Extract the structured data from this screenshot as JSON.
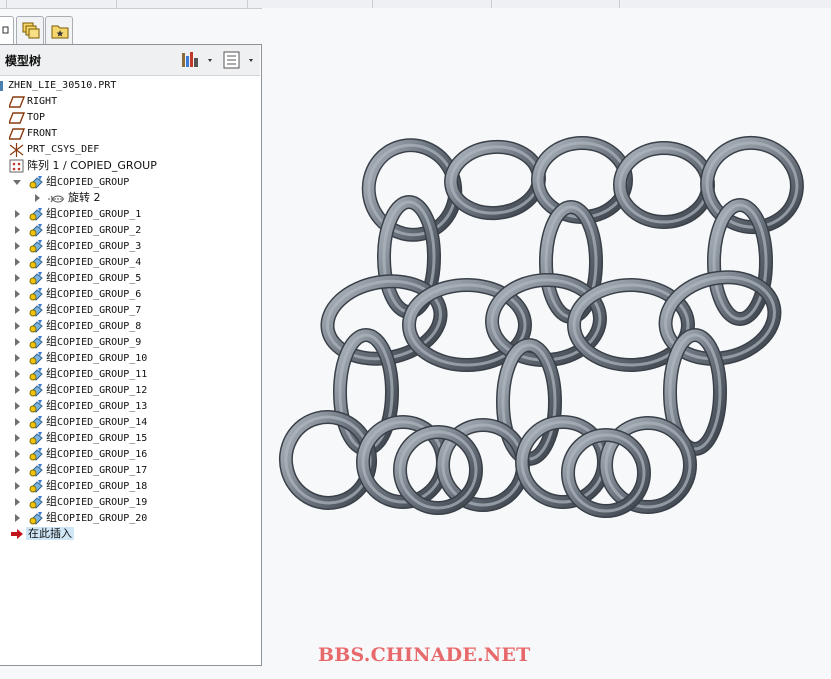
{
  "tabs": [
    {
      "icon": "model-tree-icon"
    },
    {
      "icon": "folder-layers-icon"
    },
    {
      "icon": "favorites-folder-icon"
    }
  ],
  "model_tree": {
    "title": "模型树",
    "settings_icon": "tree-settings-icon",
    "filter_icon": "tree-columns-icon",
    "root": "ZHEN_LIE_30510.PRT",
    "datum_items": [
      {
        "label": "RIGHT",
        "icon": "datum-plane-icon"
      },
      {
        "label": "TOP",
        "icon": "datum-plane-icon"
      },
      {
        "label": "FRONT",
        "icon": "datum-plane-icon"
      },
      {
        "label": "PRT_CSYS_DEF",
        "icon": "coordinate-system-icon"
      }
    ],
    "pattern": {
      "label": "阵列 1 / COPIED_GROUP",
      "icon": "pattern-icon"
    },
    "group_prefix": "组",
    "first_group": "COPIED_GROUP",
    "revolve": "旋转 2",
    "groups": [
      "COPIED_GROUP_1",
      "COPIED_GROUP_2",
      "COPIED_GROUP_3",
      "COPIED_GROUP_4",
      "COPIED_GROUP_5",
      "COPIED_GROUP_6",
      "COPIED_GROUP_7",
      "COPIED_GROUP_8",
      "COPIED_GROUP_9",
      "COPIED_GROUP_10",
      "COPIED_GROUP_11",
      "COPIED_GROUP_12",
      "COPIED_GROUP_13",
      "COPIED_GROUP_14",
      "COPIED_GROUP_15",
      "COPIED_GROUP_16",
      "COPIED_GROUP_17",
      "COPIED_GROUP_18",
      "COPIED_GROUP_19",
      "COPIED_GROUP_20"
    ],
    "insert_here": "在此插入"
  },
  "viewport": {
    "model": "chain-mail-rings",
    "ring_color": "#6d7680",
    "ring_highlight": "#aeb6bf",
    "ring_shadow": "#3a4048"
  },
  "watermark": "BBS.CHINADE.NET"
}
